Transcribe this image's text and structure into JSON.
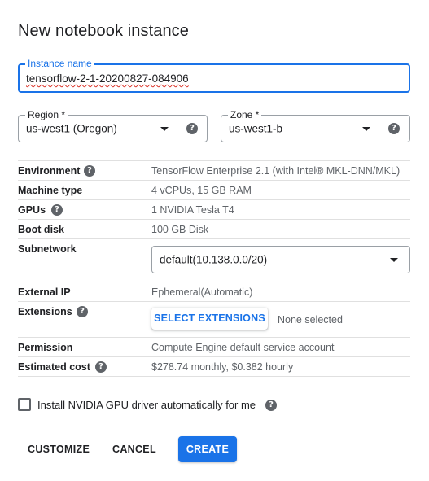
{
  "dialog": {
    "title": "New notebook instance"
  },
  "instance_name": {
    "label": "Instance name",
    "value": "tensorflow-2-1-20200827-084906"
  },
  "region": {
    "label": "Region *",
    "value": "us-west1 (Oregon)"
  },
  "zone": {
    "label": "Zone *",
    "value": "us-west1-b"
  },
  "details": {
    "environment": {
      "key": "Environment",
      "value": "TensorFlow Enterprise 2.1 (with Intel® MKL-DNN/MKL)"
    },
    "machine_type": {
      "key": "Machine type",
      "value": "4 vCPUs, 15 GB RAM"
    },
    "gpus": {
      "key": "GPUs",
      "value": "1 NVIDIA Tesla T4"
    },
    "boot_disk": {
      "key": "Boot disk",
      "value": "100 GB Disk"
    },
    "subnetwork": {
      "key": "Subnetwork",
      "value": "default(10.138.0.0/20)"
    },
    "external_ip": {
      "key": "External IP",
      "value": "Ephemeral(Automatic)"
    },
    "extensions": {
      "key": "Extensions",
      "button": "SELECT EXTENSIONS",
      "status": "None selected"
    },
    "permission": {
      "key": "Permission",
      "value": "Compute Engine default service account"
    },
    "estimated_cost": {
      "key": "Estimated cost",
      "value": "$278.74 monthly, $0.382 hourly"
    }
  },
  "gpu_driver": {
    "label": "Install NVIDIA GPU driver automatically for me",
    "checked": false
  },
  "actions": {
    "customize": "CUSTOMIZE",
    "cancel": "CANCEL",
    "create": "CREATE"
  },
  "icons": {
    "help": "help-icon",
    "dropdown": "dropdown-arrow-icon"
  },
  "colors": {
    "accent": "#1a73e8",
    "text_primary": "#202124",
    "text_secondary": "#5f6368",
    "divider": "#e0e0e0"
  }
}
